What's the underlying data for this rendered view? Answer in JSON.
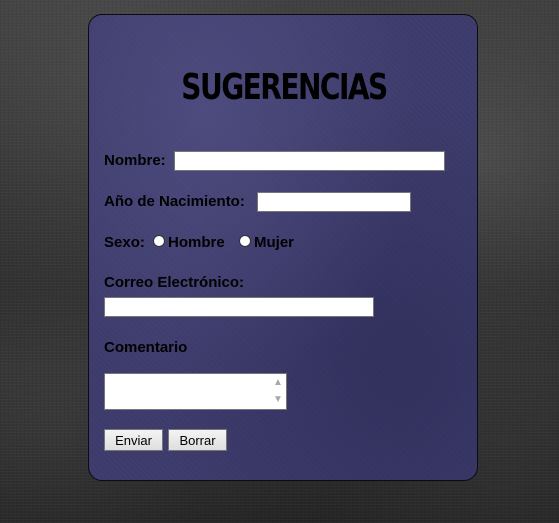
{
  "form": {
    "title": "SUGERENCIAS",
    "nombre_label": "Nombre:",
    "nombre_value": "",
    "anio_label": "Año de Nacimiento:",
    "anio_value": "",
    "sexo_label": "Sexo:",
    "sexo_options": [
      {
        "label": "Hombre",
        "selected": false
      },
      {
        "label": "Mujer",
        "selected": false
      }
    ],
    "correo_label": "Correo Electrónico:",
    "correo_value": "",
    "comentario_label": "Comentario",
    "comentario_value": "",
    "submit_label": "Enviar",
    "reset_label": "Borrar"
  },
  "colors": {
    "panel_bg": "#3d3b6b",
    "page_bg": "#2a2a2a",
    "text": "#000000"
  }
}
